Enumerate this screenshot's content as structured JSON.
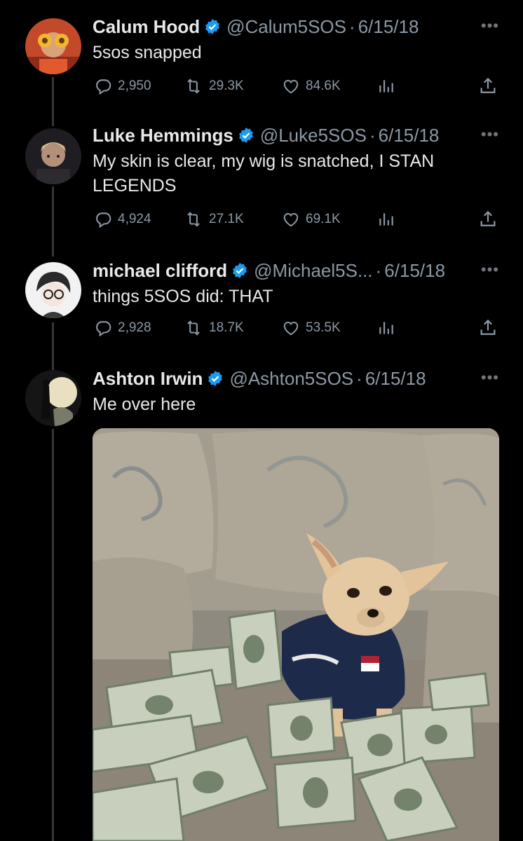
{
  "tweets": [
    {
      "name": "Calum Hood",
      "handle": "@Calum5SOS",
      "sep": "·",
      "date": "6/15/18",
      "text": "5sos snapped",
      "replies": "2,950",
      "retweets": "29.3K",
      "likes": "84.6K"
    },
    {
      "name": "Luke Hemmings",
      "handle": "@Luke5SOS",
      "sep": "·",
      "date": "6/15/18",
      "text": "My skin is clear, my wig is snatched,  I STAN LEGENDS",
      "replies": "4,924",
      "retweets": "27.1K",
      "likes": "69.1K"
    },
    {
      "name": "michael clifford",
      "handle": "@Michael5S...",
      "sep": "·",
      "date": "6/15/18",
      "text": "things 5SOS did: THAT",
      "replies": "2,928",
      "retweets": "18.7K",
      "likes": "53.5K"
    },
    {
      "name": "Ashton Irwin",
      "handle": "@Ashton5SOS",
      "sep": "·",
      "date": "6/15/18",
      "text": "Me over here"
    }
  ],
  "more_label": "•••",
  "colors": {
    "background": "#000000",
    "verified": "#1d9bf0",
    "muted": "#8b98a5",
    "text": "#e7e9ea"
  },
  "icons": [
    "verified-badge-icon",
    "reply-icon",
    "retweet-icon",
    "like-icon",
    "analytics-icon",
    "share-icon",
    "more-icon"
  ]
}
